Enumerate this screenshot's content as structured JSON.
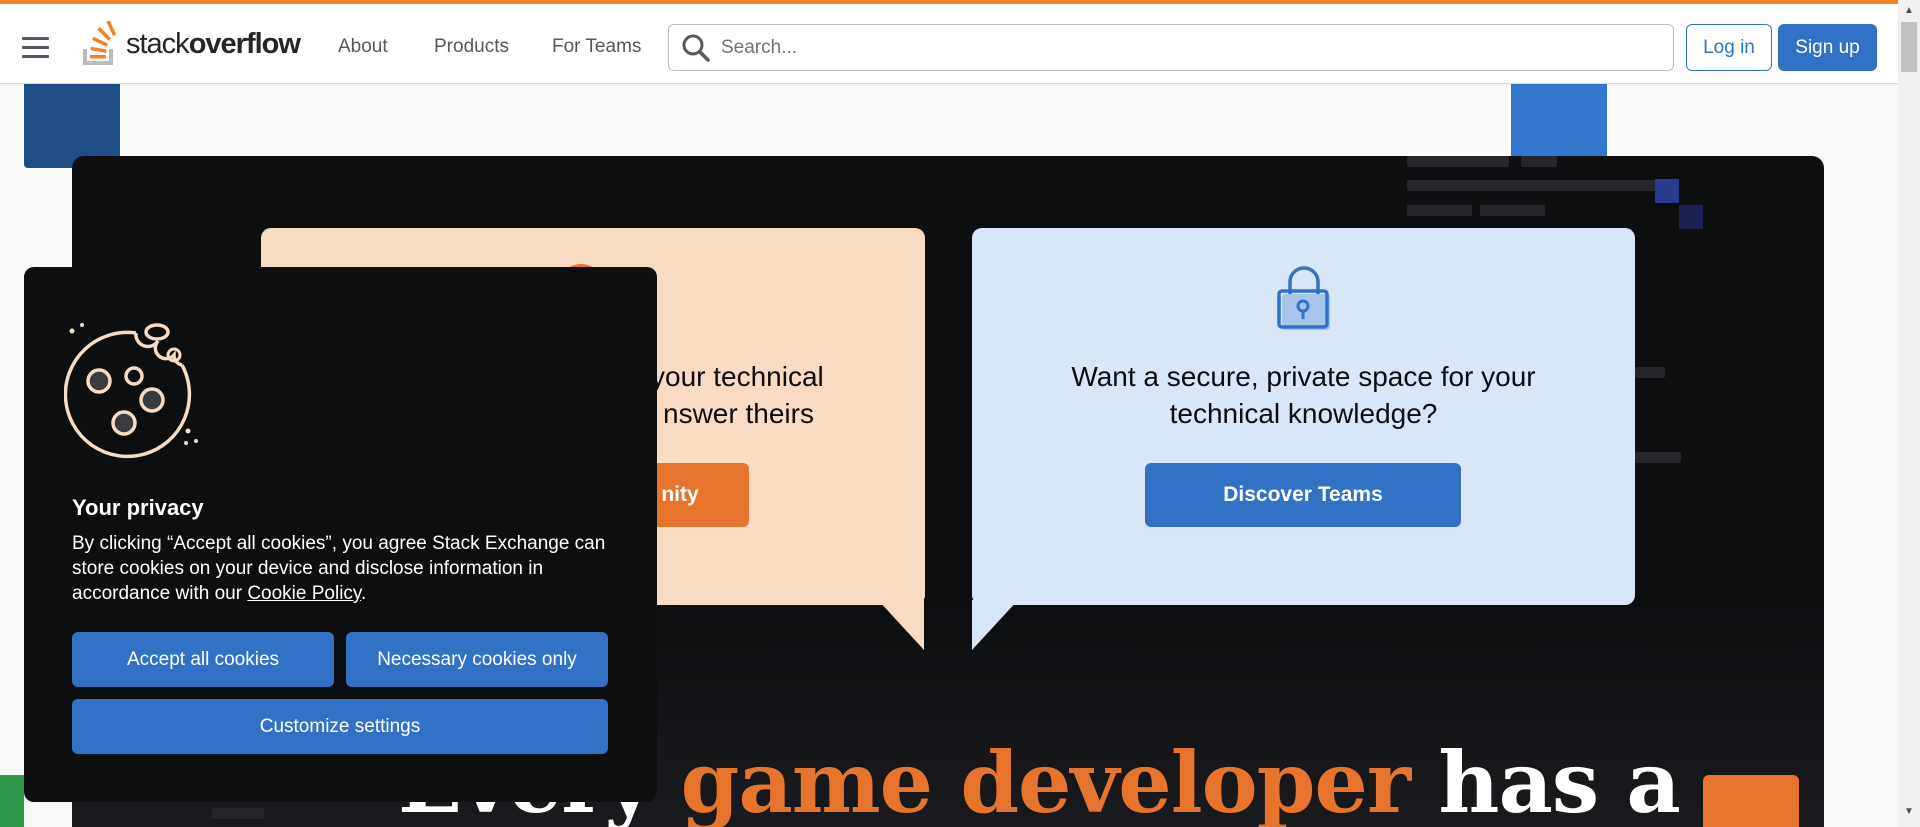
{
  "header": {
    "logo_text_light": "stack",
    "logo_text_bold": "overflow",
    "nav": [
      "About",
      "Products",
      "For Teams"
    ],
    "search_placeholder": "Search...",
    "login_label": "Log in",
    "signup_label": "Sign up"
  },
  "hero": {
    "community_card": {
      "line1": "your technical",
      "line2": "nswer theirs",
      "button_label": "nity",
      "link_fragment": "t"
    },
    "teams_card": {
      "line1": "Want a secure, private space for your",
      "line2": "technical knowledge?",
      "button_label": "Discover Teams"
    },
    "headline_white_start": "Every",
    "headline_accent": "game developer",
    "headline_white_end": "has a"
  },
  "cookie_dialog": {
    "title": "Your privacy",
    "body_text": "By clicking “Accept all cookies”, you agree Stack Exchange can store cookies on your device and disclose information in accordance with our ",
    "policy_link": "Cookie Policy",
    "body_end": ".",
    "accept_label": "Accept all cookies",
    "necessary_label": "Necessary cookies only",
    "customize_label": "Customize settings"
  },
  "colors": {
    "accent_orange": "#f48225",
    "primary_blue": "#3172c7",
    "hero_dark": "#0d0e10"
  }
}
